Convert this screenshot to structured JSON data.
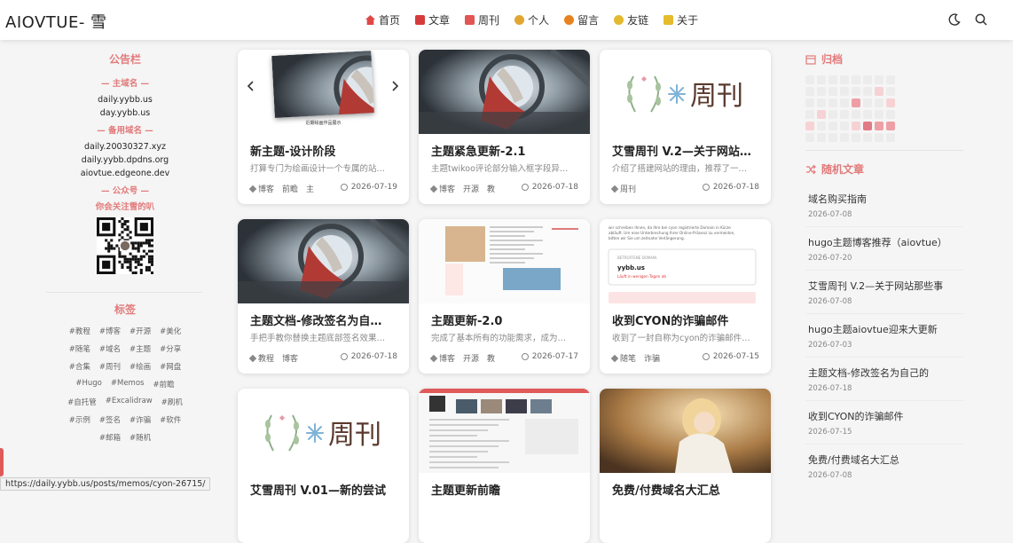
{
  "header": {
    "brand": "AIOVTUE- 雪",
    "nav": [
      {
        "label": "首页",
        "icon": "home-icon",
        "color": "#e04848"
      },
      {
        "label": "文章",
        "icon": "article-icon",
        "color": "#d63b3b"
      },
      {
        "label": "周刊",
        "icon": "weekly-icon",
        "color": "#e25555"
      },
      {
        "label": "个人",
        "icon": "person-icon",
        "color": "#e2a630"
      },
      {
        "label": "留言",
        "icon": "message-icon",
        "color": "#e8821e"
      },
      {
        "label": "友链",
        "icon": "friend-link-icon",
        "color": "#e3b92f"
      },
      {
        "label": "关于",
        "icon": "about-icon",
        "color": "#e6bb2c"
      }
    ]
  },
  "left": {
    "notice_title": "公告栏",
    "main_domain_title": "— 主域名 —",
    "main_domains": [
      "daily.yybb.us",
      "day.yybb.us"
    ],
    "backup_domain_title": "— 备用域名 —",
    "backup_domains": [
      "daily.20030327.xyz",
      "daily.yybb.dpdns.org",
      "aiovtue.edgeone.dev"
    ],
    "wechat_title": "— 公众号 —",
    "wechat_text": "你会关注雪的叭",
    "tags_title": "标签",
    "tags": [
      "#教程",
      "#博客",
      "#开源",
      "#美化",
      "#随笔",
      "#域名",
      "#主题",
      "#分享",
      "#合集",
      "#周刊",
      "#绘画",
      "#网盘",
      "#Hugo",
      "#Memos",
      "#前瞻",
      "#自托管",
      "#Excalidraw",
      "#刷机",
      "#示例",
      "#签名",
      "#诈骗",
      "#软件",
      "#邮箱",
      "#随机"
    ]
  },
  "cards": [
    {
      "title": "新主题-设计阶段",
      "desc": "打算专门为绘画设计一个专属的站…",
      "tags": [
        "博客",
        "前瞻",
        "主"
      ],
      "date": "2026-07-19",
      "thumb": "art",
      "carousel": true,
      "caption": "近期绘画作品展示"
    },
    {
      "title": "主题紧急更新-2.1",
      "desc": "主题twikoo评论部分输入框字段异…",
      "tags": [
        "博客",
        "开源",
        "教"
      ],
      "date": "2026-07-18",
      "thumb": "art"
    },
    {
      "title": "艾雪周刊 V.2—关于网站…",
      "desc": "介绍了搭建网站的理由，推荐了一…",
      "tags": [
        "周刊"
      ],
      "date": "2026-07-18",
      "thumb": "weekly",
      "logo": "周刊"
    },
    {
      "title": "主题文档-修改签名为自…",
      "desc": "手把手教你替换主题底部签名效果…",
      "tags": [
        "教程",
        "博客"
      ],
      "date": "2026-07-18",
      "thumb": "art"
    },
    {
      "title": "主题更新-2.0",
      "desc": "完成了基本所有的功能需求，成为…",
      "tags": [
        "博客",
        "开源",
        "教"
      ],
      "date": "2026-07-17",
      "thumb": "screenshot"
    },
    {
      "title": "收到CYON的诈骗邮件",
      "desc": "收到了一封自称为cyon的诈骗邮件…",
      "tags": [
        "随笔",
        "诈骗"
      ],
      "date": "2026-07-15",
      "thumb": "email",
      "email_lines": [
        "wir schreiben Ihnen, da Ihre bei cyon registrierte Domain in Kürze",
        "abläuft. Um eine Unterbrechung Ihrer Online-Präsenz zu vermeiden,",
        "bitten wir Sie um zeitnahe Verlängerung."
      ],
      "email_label": "BETROFFENE DOMAIN",
      "email_domain": "yybb.us",
      "email_warn": "Läuft in wenigen Tagen ab"
    },
    {
      "title": "艾雪周刊 V.01—新的尝试",
      "desc": "",
      "tags": [],
      "date": "",
      "thumb": "weekly",
      "logo": "周刊"
    },
    {
      "title": "主题更新前瞻",
      "desc": "",
      "tags": [],
      "date": "",
      "thumb": "screenshot2"
    },
    {
      "title": "免费/付费域名大汇总",
      "desc": "",
      "tags": [],
      "date": "",
      "thumb": "girl"
    }
  ],
  "right": {
    "archive_title": "归档",
    "heatmap": [
      0,
      0,
      0,
      0,
      0,
      0,
      0,
      0,
      0,
      0,
      0,
      0,
      0,
      0,
      1,
      0,
      0,
      0,
      0,
      0,
      2,
      0,
      0,
      1,
      0,
      1,
      0,
      0,
      0,
      0,
      0,
      0,
      1,
      0,
      0,
      0,
      1,
      3,
      2,
      2,
      0,
      0,
      0,
      0,
      0,
      0,
      0,
      0
    ],
    "random_title": "随机文章",
    "posts": [
      {
        "title": "域名购买指南",
        "date": "2026-07-08"
      },
      {
        "title": "hugo主题博客推荐（aiovtue）",
        "date": "2026-07-20"
      },
      {
        "title": "艾雪周刊 V.2—关于网站那些事",
        "date": "2026-07-08"
      },
      {
        "title": "hugo主题aiovtue迎来大更新",
        "date": "2026-07-03"
      },
      {
        "title": "主题文档-修改签名为自己的",
        "date": "2026-07-18"
      },
      {
        "title": "收到CYON的诈骗邮件",
        "date": "2026-07-15"
      },
      {
        "title": "免费/付费域名大汇总",
        "date": "2026-07-08"
      }
    ]
  },
  "status_url": "https://daily.yybb.us/posts/memos/cyon-26715/",
  "colors": {
    "accent": "#e27a7a",
    "heat0": "#ececec",
    "heat1": "#f6d2d5",
    "heat2": "#ee9fa5",
    "heat3": "#e07a83"
  }
}
